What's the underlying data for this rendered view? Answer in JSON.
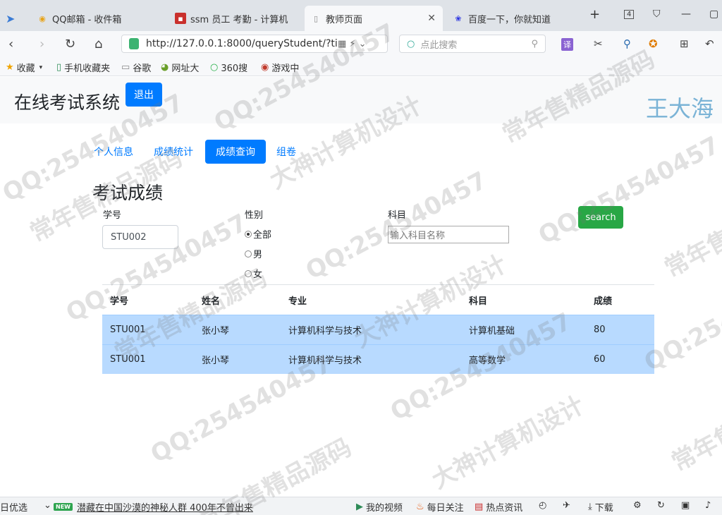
{
  "browser": {
    "tabs": [
      {
        "label": "QQ邮箱 - 收件箱",
        "icon": "qq-mail-icon"
      },
      {
        "label": "ssm 员工 考勤 - 计算机",
        "icon": "site-icon"
      },
      {
        "label": "教师页面",
        "icon": "page-icon"
      },
      {
        "label": "百度一下，你就知道",
        "icon": "baidu-icon"
      }
    ],
    "tab_count": "4",
    "url": "http://127.0.0.1:8000/queryStudent/?ti",
    "search_placeholder": "点此搜索",
    "bookmarks": [
      "收藏",
      "手机收藏夹",
      "谷歌",
      "网址大",
      "360搜",
      "游戏中"
    ]
  },
  "header": {
    "title": "在线考试系统",
    "logout_label": "退出",
    "user_name": "王大海"
  },
  "nav": {
    "items": [
      "个人信息",
      "成绩统计",
      "成绩查询",
      "组卷"
    ],
    "active": "成绩查询"
  },
  "page": {
    "section_title": "考试成绩"
  },
  "filters": {
    "student_id_label": "学号",
    "student_id_value": "STU002",
    "gender_label": "性别",
    "gender_options": [
      "全部",
      "男",
      "女"
    ],
    "gender_selected": "全部",
    "subject_label": "科目",
    "subject_placeholder": "输入科目名称",
    "search_label": "search"
  },
  "table": {
    "headers": [
      "学号",
      "姓名",
      "专业",
      "科目",
      "成绩"
    ],
    "rows": [
      [
        "STU001",
        "张小琴",
        "计算机科学与技术",
        "计算机基础",
        "80"
      ],
      [
        "STU001",
        "张小琴",
        "计算机科学与技术",
        "高等数学",
        "60"
      ]
    ]
  },
  "statusbar": {
    "left_text": "日优选",
    "news_badge": "NEW",
    "news_text": "潜藏在中国沙漠的神秘人群 400年不曾出来",
    "items": [
      "我的视频",
      "每日关注",
      "热点资讯",
      "下载"
    ]
  },
  "watermarks": [
    "QQ:254540457",
    "常年售精品源码",
    "大神计算机设计"
  ],
  "colors": {
    "primary": "#007bff",
    "success": "#28a745",
    "row_highlight": "#b8daff",
    "user_name": "#7ab3d6"
  }
}
